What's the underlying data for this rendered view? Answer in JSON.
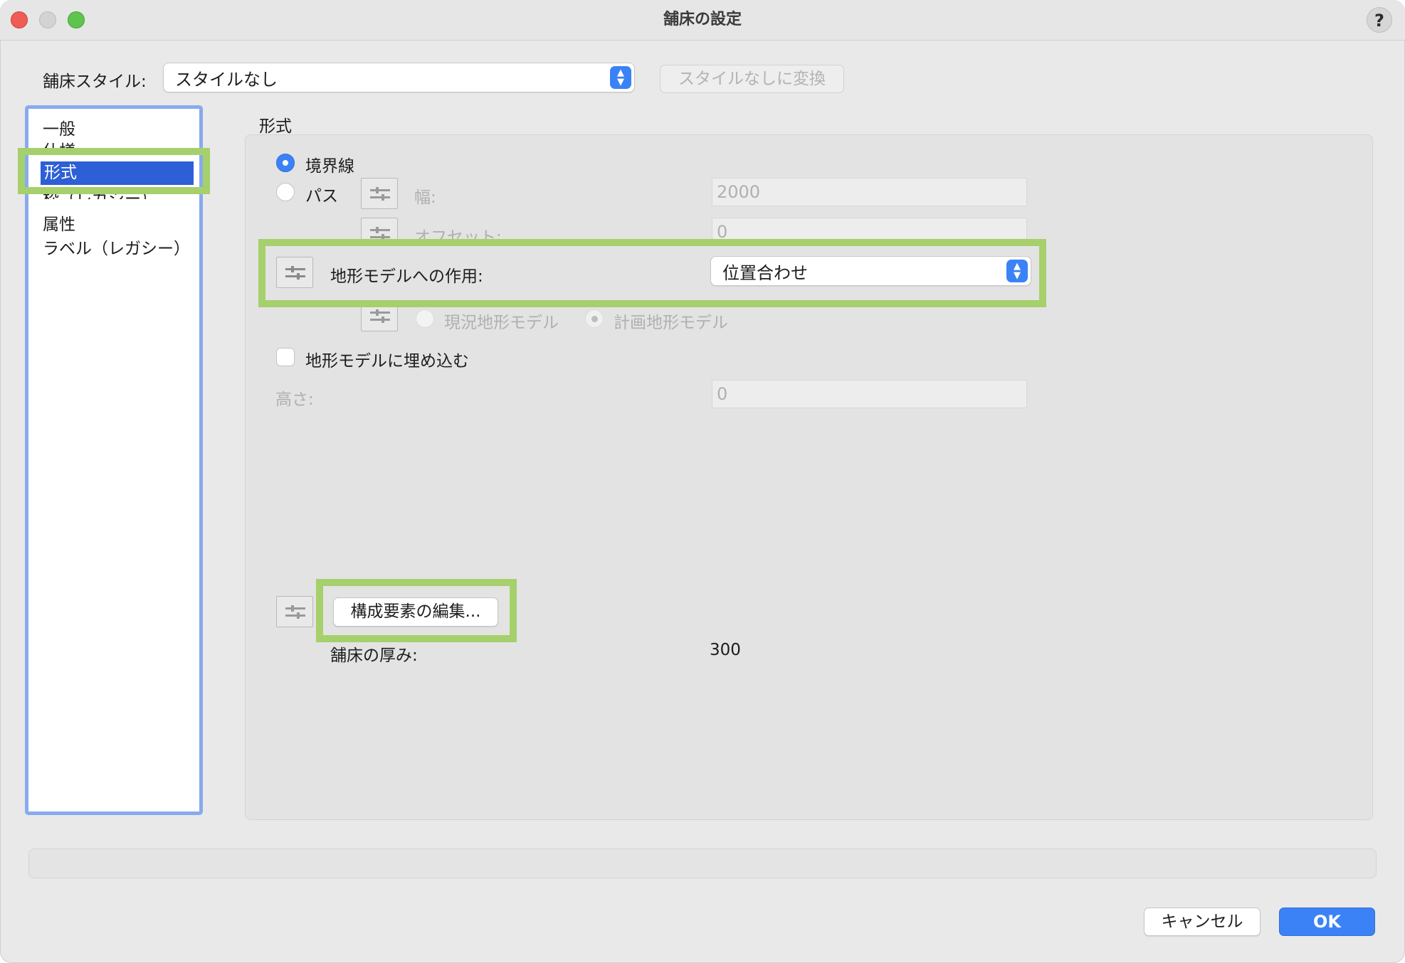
{
  "window": {
    "title": "舗床の設定",
    "help": "?"
  },
  "style_row": {
    "label": "舗床スタイル:",
    "value": "スタイルなし",
    "convert_button": "スタイルなしに変換"
  },
  "sidebar": {
    "items": [
      {
        "label": "一般"
      },
      {
        "label": "仕様"
      },
      {
        "label": "形式",
        "selected": true
      },
      {
        "label": "枠（レガシー）"
      },
      {
        "label": "属性"
      },
      {
        "label": "ラベル（レガシー）"
      }
    ]
  },
  "panel": {
    "section_title": "形式",
    "radio_boundary": "境界線",
    "radio_path": "パス",
    "width_label": "幅:",
    "width_value": "2000",
    "offset_label": "オフセット:",
    "offset_value": "0",
    "terrain_label": "地形モデルへの作用:",
    "terrain_value": "位置合わせ",
    "radio_existing": "現況地形モデル",
    "radio_proposed": "計画地形モデル",
    "embed_label": "地形モデルに埋め込む",
    "height_label": "高さ:",
    "height_value": "0",
    "edit_components_button": "構成要素の編集...",
    "thickness_label": "舗床の厚み:",
    "thickness_value": "300"
  },
  "footer": {
    "cancel": "キャンセル",
    "ok": "OK"
  },
  "colors": {
    "accent": "#3b82f6",
    "highlight": "#a6d06b",
    "selection": "#2d5fd6"
  }
}
